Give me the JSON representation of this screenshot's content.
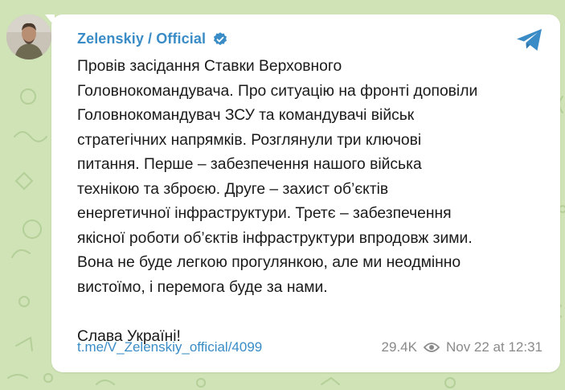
{
  "colors": {
    "background": "#cfe3b6",
    "bubble": "#ffffff",
    "accent": "#3a8cc6",
    "text": "#1a1a1a",
    "meta": "#8a8a8a"
  },
  "post": {
    "channel_name": "Zelenskiy / Official",
    "verified_icon": "verified-badge-icon",
    "share_icon": "telegram-plane-icon",
    "lines": [
      "Провів засідання Ставки Верховного",
      "Головнокомандувача. Про ситуацію на фронті доповіли",
      "Головнокомандувач ЗСУ та командувачі військ",
      "стратегічних напрямків. Розглянули три ключові",
      "питання. Перше – забезпечення нашого війська",
      "технікою та зброєю. Друге – захист об’єктів",
      "енергетичної інфраструктури. Третє – забезпечення",
      "якісної роботи об’єктів інфраструктури впродовж зими.",
      "Вона не буде легкою прогулянкою, але ми неодмінно",
      "вистоїмо, і перемога буде за нами.",
      "",
      "Слава Україні!"
    ],
    "link": "t.me/V_Zelenskiy_official/4099",
    "views": "29.4K",
    "views_icon": "eye-icon",
    "date": "Nov 22 at 12:31"
  }
}
